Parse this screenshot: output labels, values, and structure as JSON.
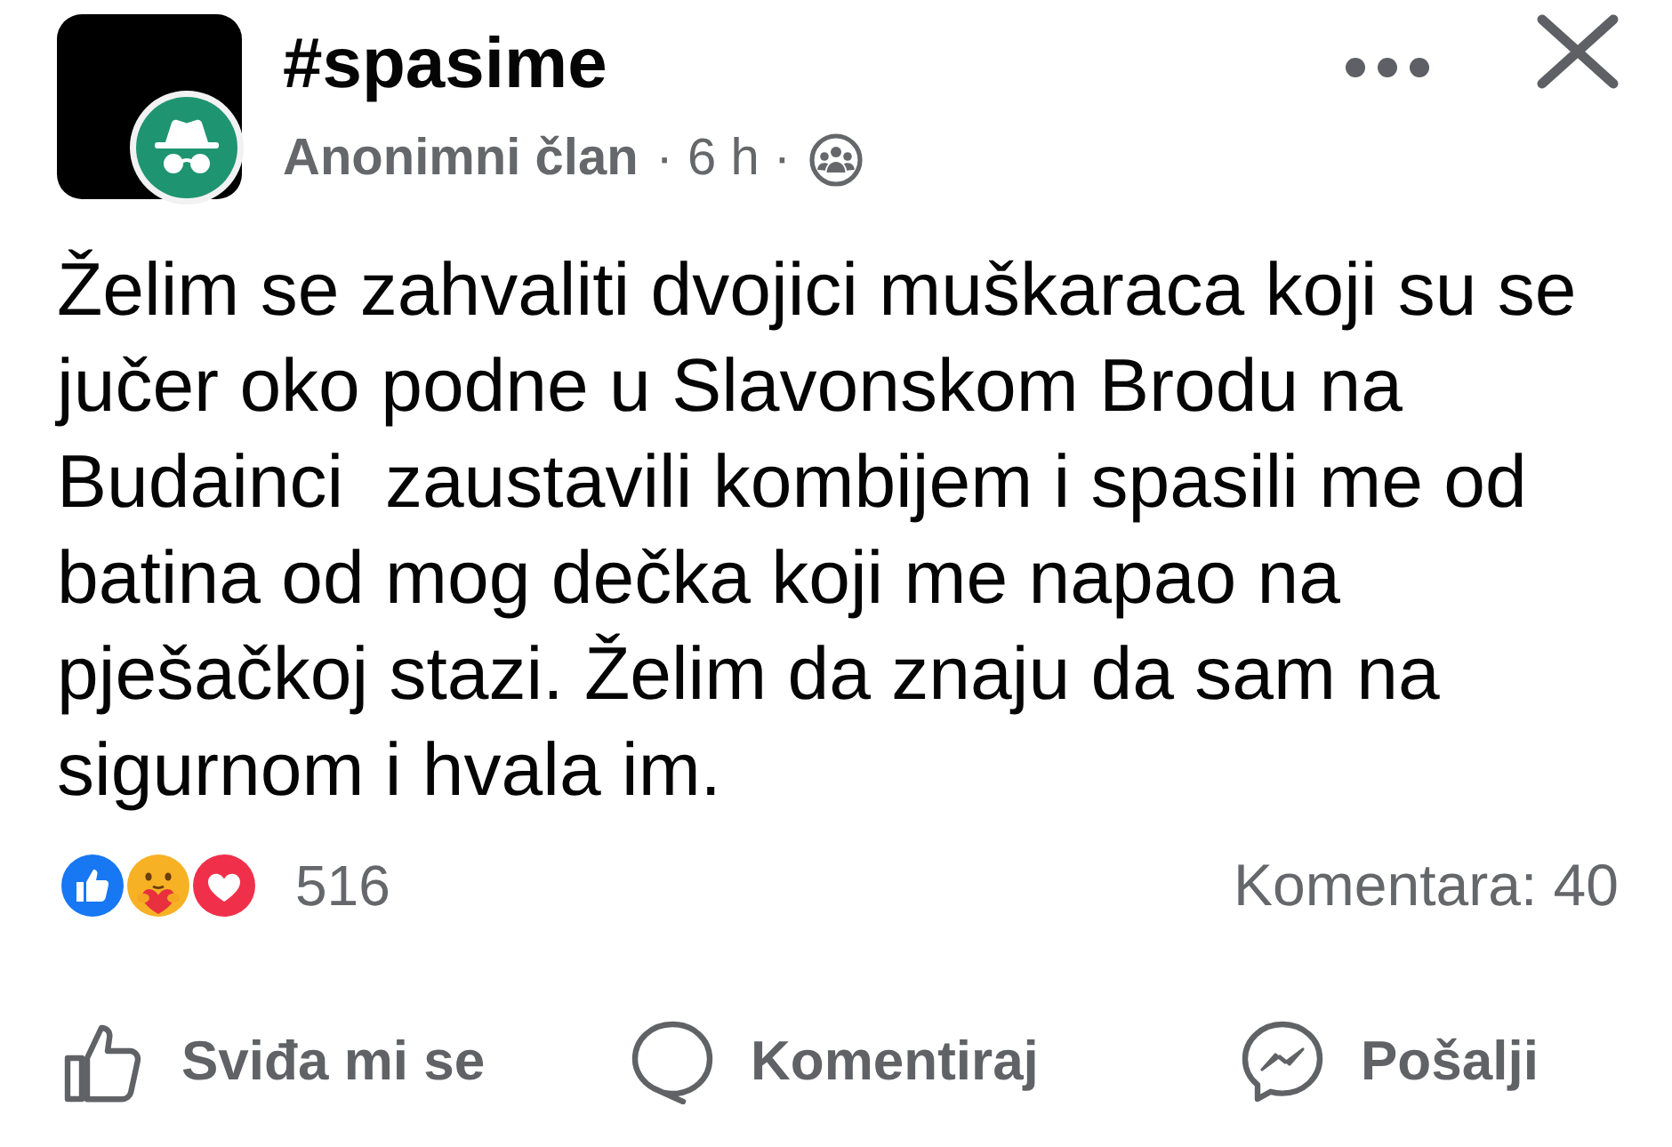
{
  "post": {
    "group_name": "#spasime",
    "author": "Anonimni član",
    "time": "· 6 h ·",
    "text": "Želim se zahvaliti dvojici muškaraca koji su se jučer oko podne u Slavonskom Brodu na Budainci  zaustavili kombijem i spasili me od batina od mog dečka koji me napao na pješačkoj stazi. Želim da znaju da sam na sigurnom i hvala im."
  },
  "reactions": {
    "items": [
      {
        "kind": "like"
      },
      {
        "kind": "care"
      },
      {
        "kind": "love"
      }
    ],
    "count": "516",
    "comments": "Komentara: 40"
  },
  "actions": [
    {
      "kind": "like",
      "label": "Sviđa mi se"
    },
    {
      "kind": "comment",
      "label": "Komentiraj"
    },
    {
      "kind": "send",
      "label": "Pošalji"
    }
  ]
}
